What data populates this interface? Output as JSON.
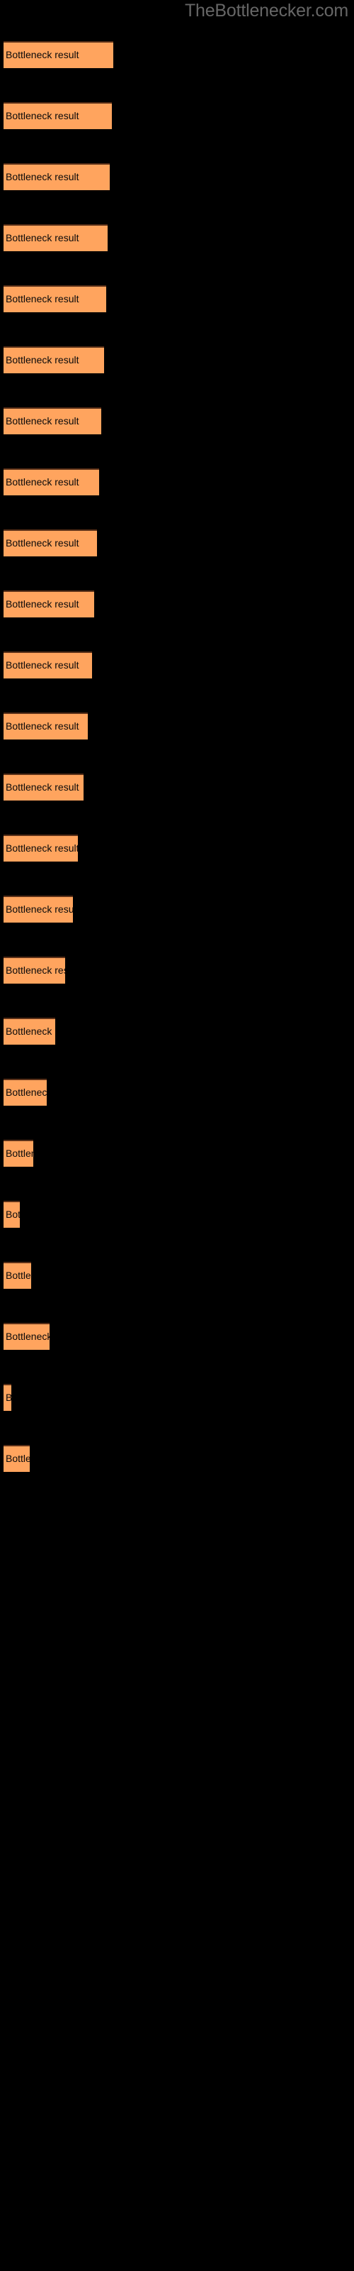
{
  "site_title": "TheBottlenecker.com",
  "colors": {
    "background": "#000000",
    "bar_fill": "#FFA45E",
    "bar_top_border": "#5A3018",
    "bar_label_text": "#0A0A0A",
    "title_text": "#666666"
  },
  "chart_data": {
    "type": "bar",
    "orientation": "horizontal",
    "title": "TheBottlenecker.com",
    "xlabel": "",
    "ylabel": "",
    "grid": false,
    "legend": false,
    "categories": [
      "Bottleneck result",
      "Bottleneck result",
      "Bottleneck result",
      "Bottleneck result",
      "Bottleneck result",
      "Bottleneck result",
      "Bottleneck result",
      "Bottleneck result",
      "Bottleneck result",
      "Bottleneck result",
      "Bottleneck result",
      "Bottleneck result",
      "Bottleneck result",
      "Bottleneck result",
      "Bottleneck result",
      "Bottleneck result",
      "Bottleneck result",
      "Bottleneck result",
      "Bottleneck result",
      "Bottleneck result",
      "Bottleneck result",
      "Bottleneck result",
      "Bottleneck result",
      "Bottleneck result"
    ],
    "bar_label": "Bottleneck result",
    "values": [
      155,
      153,
      150,
      147,
      145,
      142,
      138,
      135,
      132,
      128,
      125,
      119,
      113,
      105,
      98,
      87,
      73,
      61,
      42,
      23,
      39,
      65,
      11,
      37
    ],
    "xlim": [
      0,
      500
    ]
  },
  "bars": [
    {
      "label": "Bottleneck result",
      "width": 155,
      "top": 58
    },
    {
      "label": "Bottleneck result",
      "width": 153,
      "top": 144
    },
    {
      "label": "Bottleneck result",
      "width": 150,
      "top": 230
    },
    {
      "label": "Bottleneck result",
      "width": 147,
      "top": 316
    },
    {
      "label": "Bottleneck result",
      "width": 145,
      "top": 402
    },
    {
      "label": "Bottleneck result",
      "width": 142,
      "top": 488
    },
    {
      "label": "Bottleneck result",
      "width": 138,
      "top": 574
    },
    {
      "label": "Bottleneck result",
      "width": 135,
      "top": 660
    },
    {
      "label": "Bottleneck result",
      "width": 132,
      "top": 746
    },
    {
      "label": "Bottleneck result",
      "width": 128,
      "top": 832
    },
    {
      "label": "Bottleneck result",
      "width": 125,
      "top": 918
    },
    {
      "label": "Bottleneck result",
      "width": 119,
      "top": 1004
    },
    {
      "label": "Bottleneck result",
      "width": 113,
      "top": 1090
    },
    {
      "label": "Bottleneck result",
      "width": 105,
      "top": 1176
    },
    {
      "label": "Bottleneck result",
      "width": 98,
      "top": 1262
    },
    {
      "label": "Bottleneck result",
      "width": 87,
      "top": 1348
    },
    {
      "label": "Bottleneck result",
      "width": 73,
      "top": 1434
    },
    {
      "label": "Bottleneck result",
      "width": 61,
      "top": 1520
    },
    {
      "label": "Bottleneck result",
      "width": 42,
      "top": 1606
    },
    {
      "label": "Bottleneck result",
      "width": 23,
      "top": 1692
    },
    {
      "label": "Bottleneck result",
      "width": 39,
      "top": 1778
    },
    {
      "label": "Bottleneck result",
      "width": 65,
      "top": 1864
    },
    {
      "label": "Bottleneck result",
      "width": 11,
      "top": 1950
    },
    {
      "label": "Bottleneck result",
      "width": 37,
      "top": 2036
    }
  ]
}
